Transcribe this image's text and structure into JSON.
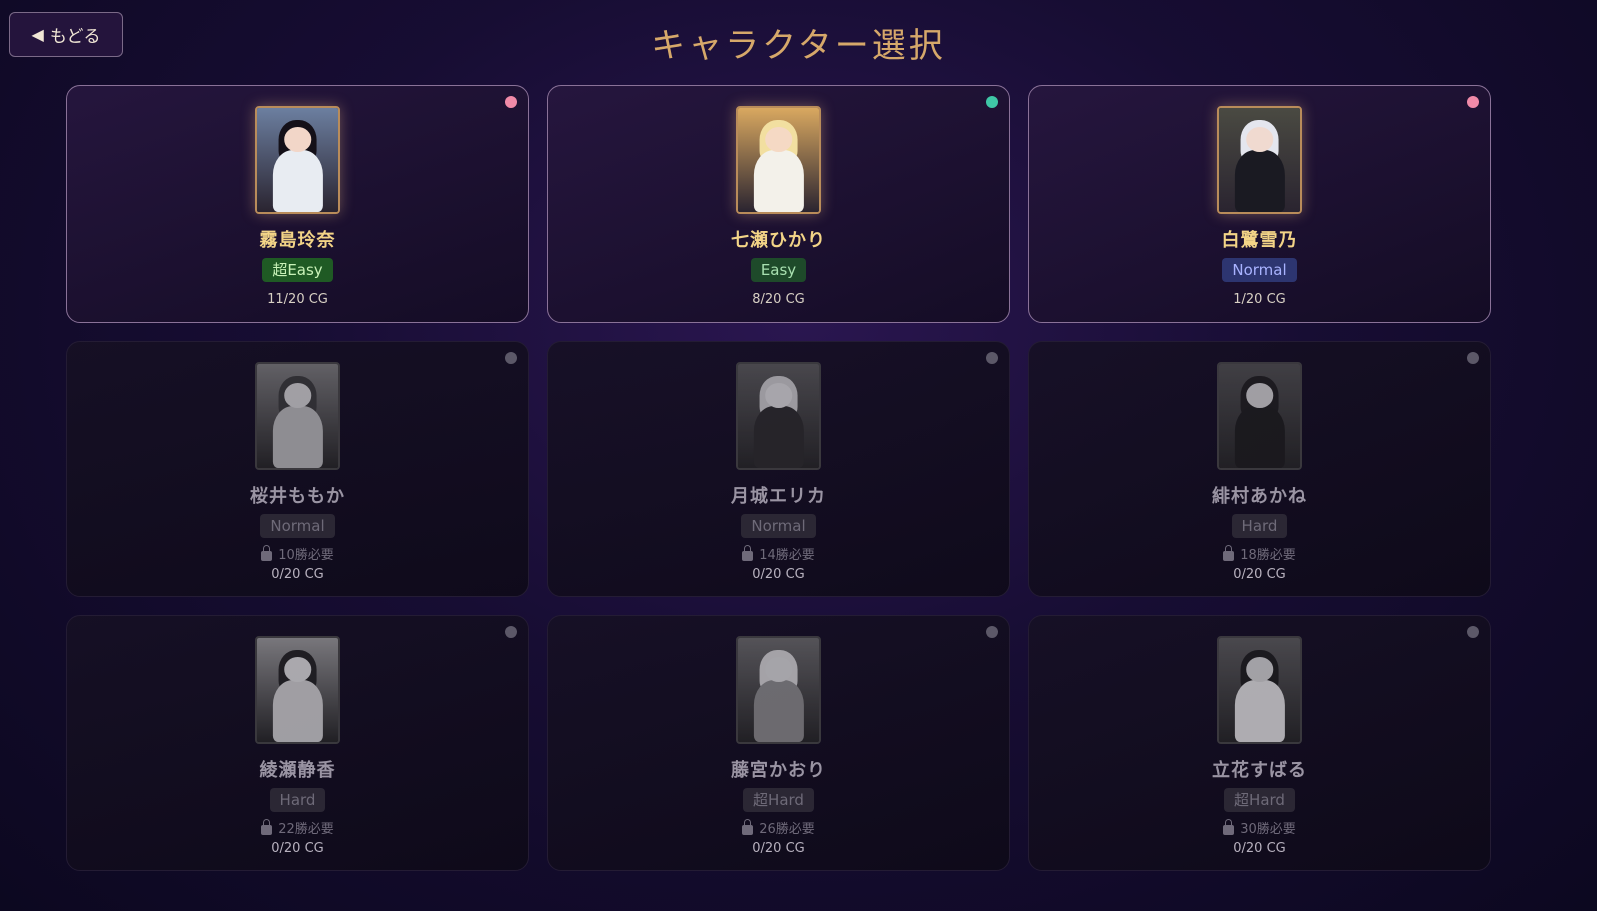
{
  "header": {
    "back_label": "もどる",
    "back_icon": "triangle-left-icon",
    "title": "キャラクター選択"
  },
  "colors": {
    "title": "#d6a86a",
    "name_unlocked": "#f3d487",
    "dot_pink": "#f08aa8",
    "dot_teal": "#3fc7a6",
    "dot_gray": "#5c5868"
  },
  "characters": [
    {
      "name": "霧島玲奈",
      "difficulty": "超Easy",
      "difficulty_bg": "#1f5a24",
      "difficulty_fg": "#c9f2b8",
      "cg": "11/20 CG",
      "locked": false,
      "dot": "#f08aa8",
      "palette": {
        "bg": "#6c7fa0",
        "hair": "#141018",
        "skin": "#f2d6c8",
        "body": "#e8ecf2"
      }
    },
    {
      "name": "七瀬ひかり",
      "difficulty": "Easy",
      "difficulty_bg": "#1e4a2a",
      "difficulty_fg": "#a8e0b0",
      "cg": "8/20 CG",
      "locked": false,
      "dot": "#3fc7a6",
      "palette": {
        "bg": "#d9a860",
        "hair": "#f2dfa0",
        "skin": "#f5d9c4",
        "body": "#f3f1ea"
      }
    },
    {
      "name": "白鷺雪乃",
      "difficulty": "Normal",
      "difficulty_bg": "#2d3570",
      "difficulty_fg": "#a9b3ff",
      "cg": "1/20 CG",
      "locked": false,
      "dot": "#f08aa8",
      "palette": {
        "bg": "#4a4a42",
        "hair": "#e4e6ee",
        "skin": "#f0dad0",
        "body": "#1a1a22"
      }
    },
    {
      "name": "桜井ももか",
      "difficulty": "Normal",
      "requirement": "10勝必要",
      "cg": "0/20 CG",
      "locked": true,
      "dot": "#5c5868",
      "palette": {
        "bg": "#7c7c7c",
        "hair": "#3a3a3a",
        "skin": "#d0d0d0",
        "body": "#b8b8b8"
      }
    },
    {
      "name": "月城エリカ",
      "difficulty": "Normal",
      "requirement": "14勝必要",
      "cg": "0/20 CG",
      "locked": true,
      "dot": "#5c5868",
      "palette": {
        "bg": "#5a5a5a",
        "hair": "#c8c8c8",
        "skin": "#d8d8d8",
        "body": "#2c2c2c"
      }
    },
    {
      "name": "緋村あかね",
      "difficulty": "Hard",
      "requirement": "18勝必要",
      "cg": "0/20 CG",
      "locked": true,
      "dot": "#5c5868",
      "palette": {
        "bg": "#505050",
        "hair": "#202020",
        "skin": "#cfcfcf",
        "body": "#1e1e1e"
      }
    },
    {
      "name": "綾瀬静香",
      "difficulty": "Hard",
      "requirement": "22勝必要",
      "cg": "0/20 CG",
      "locked": true,
      "dot": "#5c5868",
      "palette": {
        "bg": "#9a9a9a",
        "hair": "#242424",
        "skin": "#dcdcdc",
        "body": "#cfcfcf"
      }
    },
    {
      "name": "藤宮かおり",
      "difficulty": "超Hard",
      "requirement": "26勝必要",
      "cg": "0/20 CG",
      "locked": true,
      "dot": "#5c5868",
      "palette": {
        "bg": "#6a6a6a",
        "hair": "#d4d4d4",
        "skin": "#d6d6d6",
        "body": "#8a8a8a"
      }
    },
    {
      "name": "立花すばる",
      "difficulty": "超Hard",
      "requirement": "30勝必要",
      "cg": "0/20 CG",
      "locked": true,
      "dot": "#5c5868",
      "palette": {
        "bg": "#5c5c5c",
        "hair": "#1e1e1e",
        "skin": "#d2d2d2",
        "body": "#e2e2e2"
      }
    }
  ]
}
